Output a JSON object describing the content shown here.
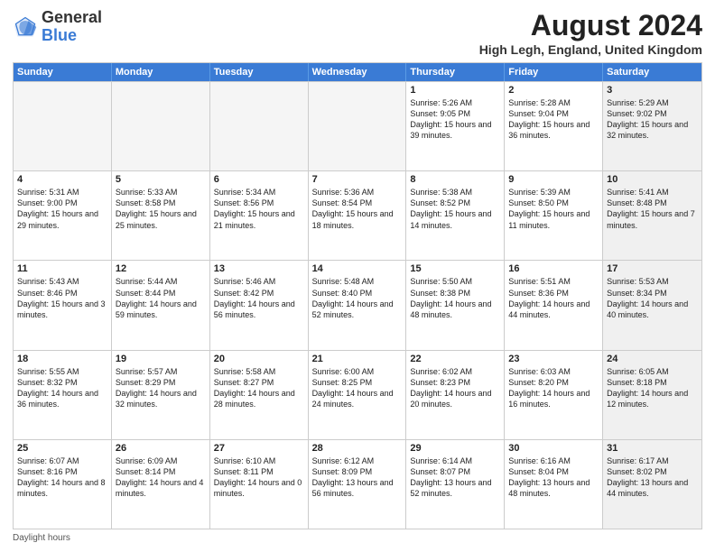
{
  "logo": {
    "general": "General",
    "blue": "Blue"
  },
  "title": "August 2024",
  "location": "High Legh, England, United Kingdom",
  "days": [
    "Sunday",
    "Monday",
    "Tuesday",
    "Wednesday",
    "Thursday",
    "Friday",
    "Saturday"
  ],
  "footer": "Daylight hours",
  "weeks": [
    [
      {
        "day": "",
        "info": "",
        "empty": true
      },
      {
        "day": "",
        "info": "",
        "empty": true
      },
      {
        "day": "",
        "info": "",
        "empty": true
      },
      {
        "day": "",
        "info": "",
        "empty": true
      },
      {
        "day": "1",
        "info": "Sunrise: 5:26 AM\nSunset: 9:05 PM\nDaylight: 15 hours\nand 39 minutes.",
        "empty": false
      },
      {
        "day": "2",
        "info": "Sunrise: 5:28 AM\nSunset: 9:04 PM\nDaylight: 15 hours\nand 36 minutes.",
        "empty": false
      },
      {
        "day": "3",
        "info": "Sunrise: 5:29 AM\nSunset: 9:02 PM\nDaylight: 15 hours\nand 32 minutes.",
        "empty": false,
        "shaded": true
      }
    ],
    [
      {
        "day": "4",
        "info": "Sunrise: 5:31 AM\nSunset: 9:00 PM\nDaylight: 15 hours\nand 29 minutes.",
        "empty": false
      },
      {
        "day": "5",
        "info": "Sunrise: 5:33 AM\nSunset: 8:58 PM\nDaylight: 15 hours\nand 25 minutes.",
        "empty": false
      },
      {
        "day": "6",
        "info": "Sunrise: 5:34 AM\nSunset: 8:56 PM\nDaylight: 15 hours\nand 21 minutes.",
        "empty": false
      },
      {
        "day": "7",
        "info": "Sunrise: 5:36 AM\nSunset: 8:54 PM\nDaylight: 15 hours\nand 18 minutes.",
        "empty": false
      },
      {
        "day": "8",
        "info": "Sunrise: 5:38 AM\nSunset: 8:52 PM\nDaylight: 15 hours\nand 14 minutes.",
        "empty": false
      },
      {
        "day": "9",
        "info": "Sunrise: 5:39 AM\nSunset: 8:50 PM\nDaylight: 15 hours\nand 11 minutes.",
        "empty": false
      },
      {
        "day": "10",
        "info": "Sunrise: 5:41 AM\nSunset: 8:48 PM\nDaylight: 15 hours\nand 7 minutes.",
        "empty": false,
        "shaded": true
      }
    ],
    [
      {
        "day": "11",
        "info": "Sunrise: 5:43 AM\nSunset: 8:46 PM\nDaylight: 15 hours\nand 3 minutes.",
        "empty": false
      },
      {
        "day": "12",
        "info": "Sunrise: 5:44 AM\nSunset: 8:44 PM\nDaylight: 14 hours\nand 59 minutes.",
        "empty": false
      },
      {
        "day": "13",
        "info": "Sunrise: 5:46 AM\nSunset: 8:42 PM\nDaylight: 14 hours\nand 56 minutes.",
        "empty": false
      },
      {
        "day": "14",
        "info": "Sunrise: 5:48 AM\nSunset: 8:40 PM\nDaylight: 14 hours\nand 52 minutes.",
        "empty": false
      },
      {
        "day": "15",
        "info": "Sunrise: 5:50 AM\nSunset: 8:38 PM\nDaylight: 14 hours\nand 48 minutes.",
        "empty": false
      },
      {
        "day": "16",
        "info": "Sunrise: 5:51 AM\nSunset: 8:36 PM\nDaylight: 14 hours\nand 44 minutes.",
        "empty": false
      },
      {
        "day": "17",
        "info": "Sunrise: 5:53 AM\nSunset: 8:34 PM\nDaylight: 14 hours\nand 40 minutes.",
        "empty": false,
        "shaded": true
      }
    ],
    [
      {
        "day": "18",
        "info": "Sunrise: 5:55 AM\nSunset: 8:32 PM\nDaylight: 14 hours\nand 36 minutes.",
        "empty": false
      },
      {
        "day": "19",
        "info": "Sunrise: 5:57 AM\nSunset: 8:29 PM\nDaylight: 14 hours\nand 32 minutes.",
        "empty": false
      },
      {
        "day": "20",
        "info": "Sunrise: 5:58 AM\nSunset: 8:27 PM\nDaylight: 14 hours\nand 28 minutes.",
        "empty": false
      },
      {
        "day": "21",
        "info": "Sunrise: 6:00 AM\nSunset: 8:25 PM\nDaylight: 14 hours\nand 24 minutes.",
        "empty": false
      },
      {
        "day": "22",
        "info": "Sunrise: 6:02 AM\nSunset: 8:23 PM\nDaylight: 14 hours\nand 20 minutes.",
        "empty": false
      },
      {
        "day": "23",
        "info": "Sunrise: 6:03 AM\nSunset: 8:20 PM\nDaylight: 14 hours\nand 16 minutes.",
        "empty": false
      },
      {
        "day": "24",
        "info": "Sunrise: 6:05 AM\nSunset: 8:18 PM\nDaylight: 14 hours\nand 12 minutes.",
        "empty": false,
        "shaded": true
      }
    ],
    [
      {
        "day": "25",
        "info": "Sunrise: 6:07 AM\nSunset: 8:16 PM\nDaylight: 14 hours\nand 8 minutes.",
        "empty": false
      },
      {
        "day": "26",
        "info": "Sunrise: 6:09 AM\nSunset: 8:14 PM\nDaylight: 14 hours\nand 4 minutes.",
        "empty": false
      },
      {
        "day": "27",
        "info": "Sunrise: 6:10 AM\nSunset: 8:11 PM\nDaylight: 14 hours\nand 0 minutes.",
        "empty": false
      },
      {
        "day": "28",
        "info": "Sunrise: 6:12 AM\nSunset: 8:09 PM\nDaylight: 13 hours\nand 56 minutes.",
        "empty": false
      },
      {
        "day": "29",
        "info": "Sunrise: 6:14 AM\nSunset: 8:07 PM\nDaylight: 13 hours\nand 52 minutes.",
        "empty": false
      },
      {
        "day": "30",
        "info": "Sunrise: 6:16 AM\nSunset: 8:04 PM\nDaylight: 13 hours\nand 48 minutes.",
        "empty": false
      },
      {
        "day": "31",
        "info": "Sunrise: 6:17 AM\nSunset: 8:02 PM\nDaylight: 13 hours\nand 44 minutes.",
        "empty": false,
        "shaded": true
      }
    ]
  ]
}
